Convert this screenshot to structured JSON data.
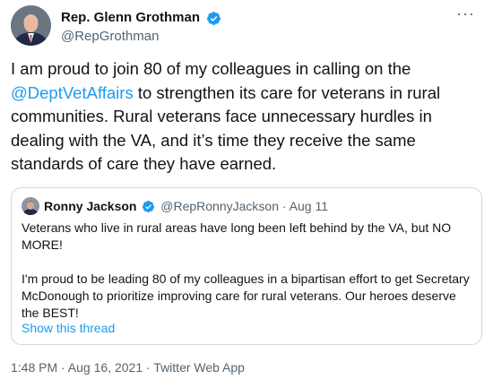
{
  "author": {
    "display_name": "Rep. Glenn Grothman",
    "handle": "@RepGrothman",
    "verified_icon": "verified-badge-icon",
    "more_icon": "more-options-icon",
    "more_glyph": "···"
  },
  "tweet": {
    "text_before_mention": "I am proud to join 80 of my colleagues in calling on the ",
    "mention": "@DeptVetAffairs",
    "text_after_mention": " to strengthen its care for veterans in rural communities. Rural veterans face unnecessary hurdles in dealing with the VA, and it’s time they receive the same standards of care they have earned."
  },
  "quoted_tweet": {
    "display_name": "Ronny Jackson",
    "handle": "@RepRonnyJackson",
    "separator": " · ",
    "date": "Aug 11",
    "paragraphs": [
      "Veterans who live in rural areas have long been left behind by the VA, but NO MORE!",
      "I'm proud to be leading 80 of my colleagues in a bipartisan effort to get Secretary McDonough to prioritize improving care for rural veterans. Our heroes deserve the BEST!"
    ],
    "show_thread": "Show this thread"
  },
  "meta": {
    "timestamp": "1:48 PM · Aug 16, 2021 · Twitter Web App"
  },
  "colors": {
    "link": "#1d9bf0",
    "secondary_text": "#536471",
    "border": "#cfd9de",
    "verified": "#1d9bf0"
  }
}
